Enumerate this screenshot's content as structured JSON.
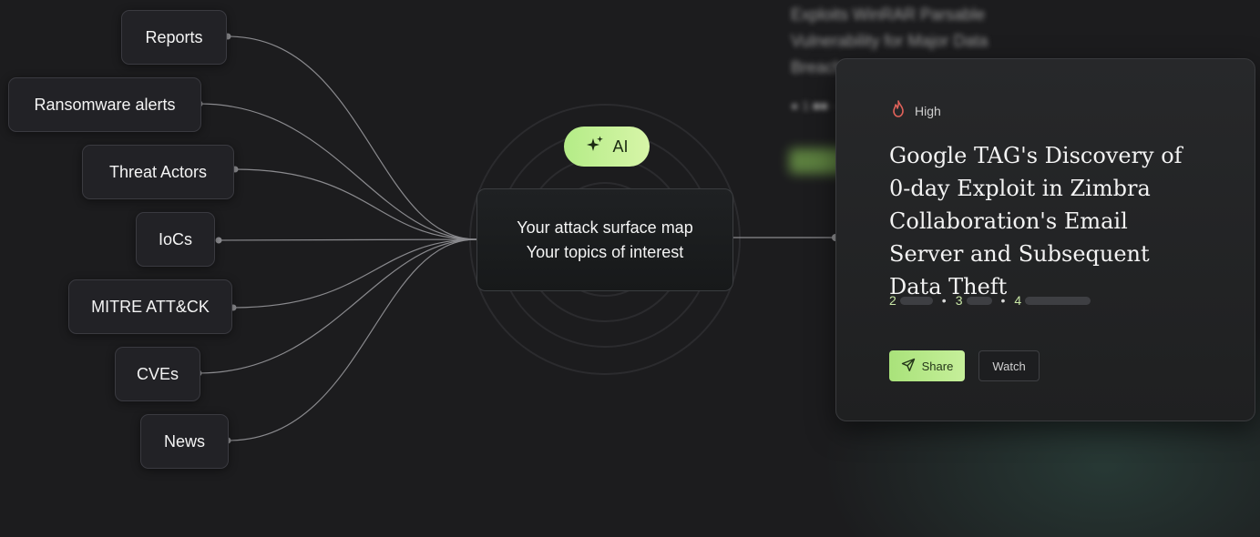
{
  "sources": [
    "Reports",
    "Ransomware alerts",
    "Threat Actors",
    "IoCs",
    "MITRE ATT&CK",
    "CVEs",
    "News"
  ],
  "ai_label": "AI",
  "hub": {
    "line1": "Your attack surface map",
    "line2": "Your topics of interest"
  },
  "card": {
    "severity": "High",
    "title": "Google TAG's Discovery of 0-day Exploit in Zimbra Collaboration's Email Server and Subsequent Data Theft",
    "meta": [
      "2",
      "3",
      "4"
    ],
    "share_label": "Share",
    "watch_label": "Watch"
  },
  "colors": {
    "accent": "#b4ec87",
    "background": "#1c1c1e",
    "severity_icon": "#e0625a"
  },
  "icons": {
    "ai": "sparkle-icon",
    "severity": "flame-icon",
    "share": "send-icon"
  }
}
